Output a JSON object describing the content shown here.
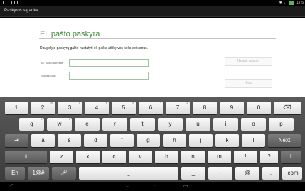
{
  "status": {
    "time": "17:5"
  },
  "app": {
    "title": "Paskyros sąranka"
  },
  "form": {
    "heading": "El. pašto paskyra",
    "subtitle": "Daugelyje paskyrų galite nustatyti el. paštą atlikę vos kelis veiksmus.",
    "email_label": "El. pašto adresas",
    "email_value": "",
    "password_label": "Slaptažodis",
    "password_value": "",
    "manual_setup_label": "Neaut. nustat.",
    "next_label": "Kitas"
  },
  "keyboard": {
    "row1": [
      {
        "k": "1",
        "a": "!"
      },
      {
        "k": "2",
        "a": "@"
      },
      {
        "k": "3",
        "a": "#"
      },
      {
        "k": "4",
        "a": "$"
      },
      {
        "k": "5",
        "a": "%"
      },
      {
        "k": "6",
        "a": "^"
      },
      {
        "k": "7",
        "a": "&"
      },
      {
        "k": "8",
        "a": "*"
      },
      {
        "k": "9",
        "a": "("
      },
      {
        "k": "0",
        "a": ")"
      }
    ],
    "row2": [
      {
        "k": "q",
        "a": "1"
      },
      {
        "k": "w",
        "a": "2"
      },
      {
        "k": "e",
        "a": ""
      },
      {
        "k": "r",
        "a": ""
      },
      {
        "k": "t",
        "a": ""
      },
      {
        "k": "y",
        "a": ""
      },
      {
        "k": "u",
        "a": ""
      },
      {
        "k": "i",
        "a": ""
      },
      {
        "k": "o",
        "a": ""
      },
      {
        "k": "p",
        "a": "+"
      }
    ],
    "row3": [
      {
        "k": "a",
        "a": ""
      },
      {
        "k": "s",
        "a": ""
      },
      {
        "k": "d",
        "a": ""
      },
      {
        "k": "f",
        "a": ""
      },
      {
        "k": "g",
        "a": ""
      },
      {
        "k": "h",
        "a": ""
      },
      {
        "k": "j",
        "a": ""
      },
      {
        "k": "k",
        "a": ""
      },
      {
        "k": "l",
        "a": ""
      }
    ],
    "row4": [
      {
        "k": "z",
        "a": ""
      },
      {
        "k": "x",
        "a": ""
      },
      {
        "k": "c",
        "a": ""
      },
      {
        "k": "v",
        "a": ""
      },
      {
        "k": "b",
        "a": ""
      },
      {
        "k": "n",
        "a": ""
      },
      {
        "k": "m",
        "a": ""
      },
      {
        "k": "!",
        "a": ""
      },
      {
        "k": "?",
        "a": ""
      }
    ],
    "next_label": "Next",
    "lang_label": "En",
    "symbols_label": "1@#",
    "at_label": "@",
    "com_label": ".com",
    "underscore_label": "_",
    "dash_label": "-",
    "period_label": "."
  }
}
